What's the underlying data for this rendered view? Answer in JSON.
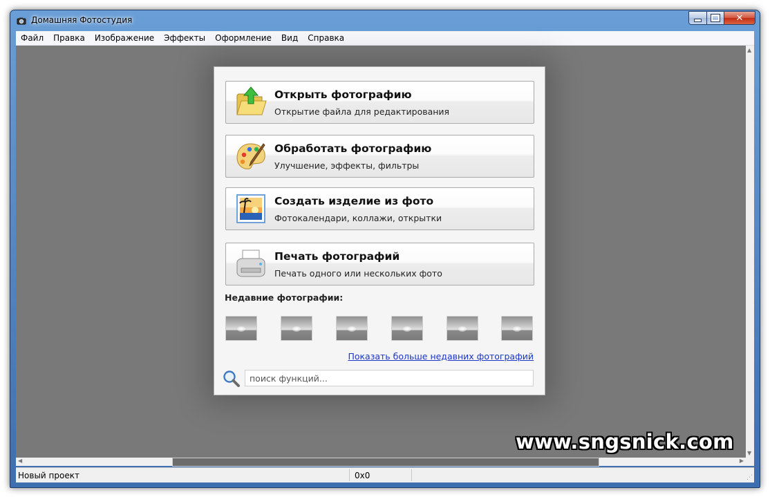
{
  "window": {
    "title": "Домашняя Фотостудия",
    "controls": {
      "minimize": "minimize",
      "maximize": "maximize",
      "close": "✕"
    }
  },
  "menu": [
    "Файл",
    "Правка",
    "Изображение",
    "Эффекты",
    "Оформление",
    "Вид",
    "Справка"
  ],
  "start_dialog": {
    "actions": [
      {
        "title": "Открыть фотографию",
        "subtitle": "Открытие файла для редактирования",
        "icon": "folder-open-icon"
      },
      {
        "title": "Обработать фотографию",
        "subtitle": "Улучшение, эффекты, фильтры",
        "icon": "palette-icon"
      },
      {
        "title": "Создать изделие из фото",
        "subtitle": "Фотокалендари, коллажи, открытки",
        "icon": "photo-icon"
      },
      {
        "title": "Печать фотографий",
        "subtitle": "Печать одного или нескольких фото",
        "icon": "printer-icon"
      }
    ],
    "recent_label": "Недавние фотографии:",
    "recent_count": 6,
    "more_link": "Показать больше недавних фотографий",
    "search_placeholder": "поиск функций..."
  },
  "statusbar": {
    "project": "Новый проект",
    "coords": "0x0"
  },
  "watermark": "www.sngsnick.com",
  "colors": {
    "client_bg": "#797979",
    "link": "#1a35c4",
    "title_gradient_top": "#6a9ed6",
    "close_red": "#c12c14"
  }
}
